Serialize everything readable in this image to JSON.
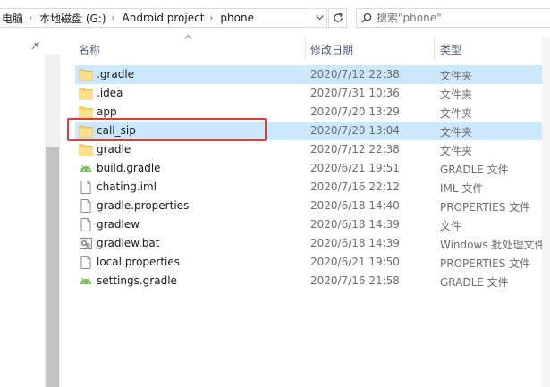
{
  "address": {
    "crumbs": [
      "电脑",
      "本地磁盘 (G:)",
      "Android project",
      "phone"
    ],
    "separator": "›"
  },
  "search": {
    "placeholder": "搜索\"phone\""
  },
  "columns": {
    "name": "名称",
    "date": "修改日期",
    "type": "类型"
  },
  "files": [
    {
      "name": ".gradle",
      "date": "2020/7/12 22:38",
      "type": "文件夹",
      "icon": "folder",
      "selected": true
    },
    {
      "name": ".idea",
      "date": "2020/7/31 10:36",
      "type": "文件夹",
      "icon": "folder",
      "selected": false
    },
    {
      "name": "app",
      "date": "2020/7/20 13:29",
      "type": "文件夹",
      "icon": "folder",
      "selected": false
    },
    {
      "name": "call_sip",
      "date": "2020/7/20 13:04",
      "type": "文件夹",
      "icon": "folder",
      "selected": true
    },
    {
      "name": "gradle",
      "date": "2020/7/12 22:38",
      "type": "文件夹",
      "icon": "folder",
      "selected": false
    },
    {
      "name": "build.gradle",
      "date": "2020/6/21 19:51",
      "type": "GRADLE 文件",
      "icon": "android",
      "selected": false
    },
    {
      "name": "chating.iml",
      "date": "2020/7/16 22:12",
      "type": "IML 文件",
      "icon": "document",
      "selected": false
    },
    {
      "name": "gradle.properties",
      "date": "2020/6/18 14:40",
      "type": "PROPERTIES 文件",
      "icon": "document",
      "selected": false
    },
    {
      "name": "gradlew",
      "date": "2020/6/18 14:39",
      "type": "文件",
      "icon": "document",
      "selected": false
    },
    {
      "name": "gradlew.bat",
      "date": "2020/6/18 14:39",
      "type": "Windows 批处理文件",
      "icon": "batch",
      "selected": false
    },
    {
      "name": "local.properties",
      "date": "2020/6/21 19:50",
      "type": "PROPERTIES 文件",
      "icon": "document",
      "selected": false
    },
    {
      "name": "settings.gradle",
      "date": "2020/7/16 21:58",
      "type": "GRADLE 文件",
      "icon": "android",
      "selected": false
    }
  ],
  "colors": {
    "selection": "#cce8ff",
    "folder": "#ffd35c",
    "android": "#78c257",
    "highlight_box": "#e03c3c"
  }
}
